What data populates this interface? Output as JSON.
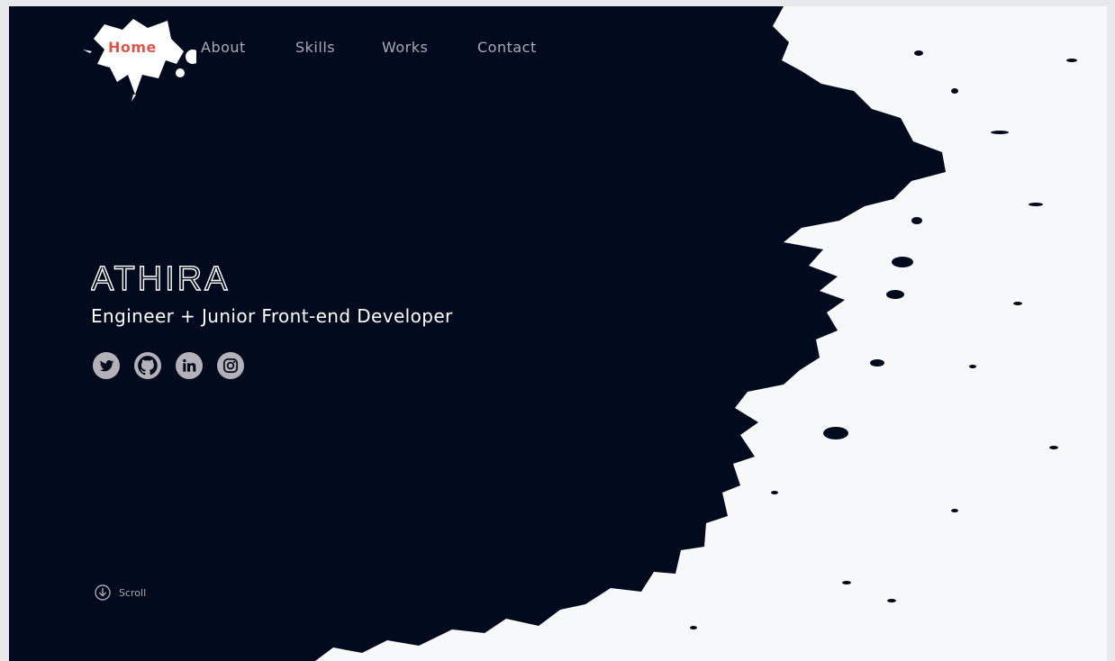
{
  "nav": {
    "items": [
      {
        "label": "Home",
        "active": true
      },
      {
        "label": "About",
        "active": false
      },
      {
        "label": "Skills",
        "active": false
      },
      {
        "label": "Works",
        "active": false
      },
      {
        "label": "Contact",
        "active": false
      }
    ]
  },
  "hero": {
    "name": "ATHIRA",
    "subtitle": "Engineer + Junior Front-end Developer"
  },
  "socials": [
    {
      "icon": "twitter-icon"
    },
    {
      "icon": "github-icon"
    },
    {
      "icon": "linkedin-icon"
    },
    {
      "icon": "instagram-icon"
    }
  ],
  "scroll": {
    "label": "Scroll"
  },
  "colors": {
    "background": "#020b1e",
    "splash": "#f7f8f9",
    "accent": "#d9574c",
    "nav_text": "#a9aab0",
    "icon_fill": "#b3b0b7"
  }
}
